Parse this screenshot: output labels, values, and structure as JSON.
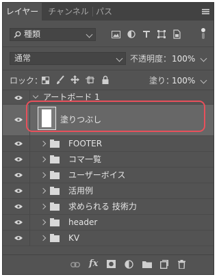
{
  "tabs": [
    {
      "label": "レイヤー",
      "active": true
    },
    {
      "label": "チャンネル",
      "active": false
    },
    {
      "label": "パス",
      "active": false
    }
  ],
  "filter": {
    "kind_label": "種類",
    "icons": [
      "image-filter-icon",
      "adjustment-filter-icon",
      "text-filter-icon",
      "shape-filter-icon",
      "smart-object-filter-icon"
    ]
  },
  "blend": {
    "mode": "通常",
    "opacity_label": "不透明度：",
    "opacity_value": "100%"
  },
  "lock": {
    "label": "ロック：",
    "fill_label": "塗り：",
    "fill_value": "100%"
  },
  "artboard": {
    "name": "アートボード 1"
  },
  "selected_layer": {
    "name": "塗りつぶし",
    "highlight_color": "#e8505b"
  },
  "folders": [
    {
      "name": "FOOTER"
    },
    {
      "name": "コマ一覧"
    },
    {
      "name": "ユーザーボイス"
    },
    {
      "name": "活用例"
    },
    {
      "name": "求められる 技術力"
    },
    {
      "name": "header"
    },
    {
      "name": "KV"
    }
  ],
  "colors": {
    "panel_bg": "#535353",
    "selected_bg": "#676767",
    "tab_bar": "#424242"
  },
  "bottom_icons": [
    "link-layers-icon",
    "fx-icon",
    "add-mask-icon",
    "adjustment-layer-icon",
    "new-group-icon",
    "new-layer-icon",
    "trash-icon"
  ],
  "bottom": {
    "fx_label": "fx"
  }
}
